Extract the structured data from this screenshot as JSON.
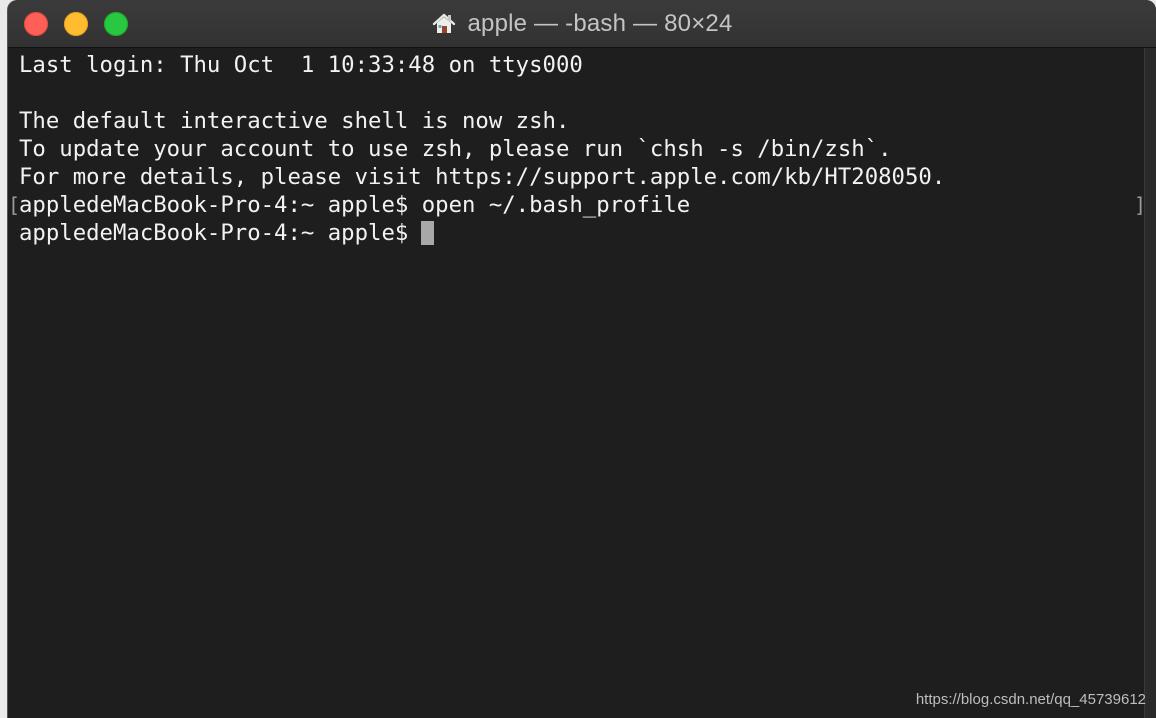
{
  "window": {
    "title": "apple — -bash — 80×24",
    "title_icon": "home-icon"
  },
  "terminal": {
    "lines": [
      "Last login: Thu Oct  1 10:33:48 on ttys000",
      "",
      "The default interactive shell is now zsh.",
      "To update your account to use zsh, please run `chsh -s /bin/zsh`.",
      "For more details, please visit https://support.apple.com/kb/HT208050.",
      "appledeMacBook-Pro-4:~ apple$ open ~/.bash_profile",
      "appledeMacBook-Pro-4:~ apple$"
    ],
    "bracket_left": "[",
    "bracket_right": "]"
  },
  "watermark": "https://blog.csdn.net/qq_45739612",
  "colors": {
    "close": "#fe5f57",
    "minimize": "#febc2e",
    "maximize": "#28c840",
    "background": "#1e1e1e",
    "text": "#f2f2f2"
  }
}
